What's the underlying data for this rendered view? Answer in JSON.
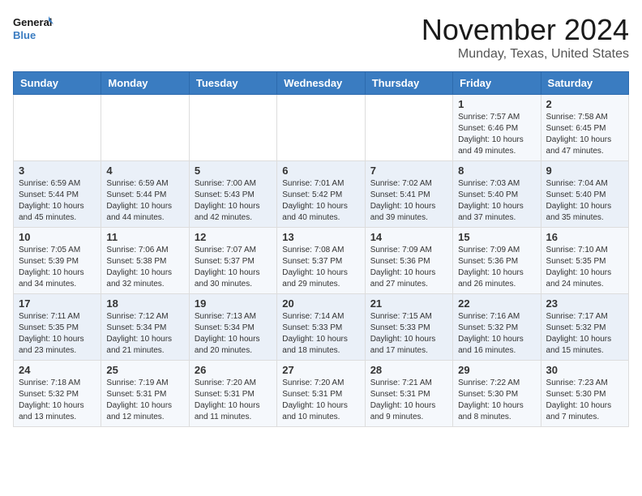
{
  "header": {
    "logo_line1": "General",
    "logo_line2": "Blue",
    "month": "November 2024",
    "location": "Munday, Texas, United States"
  },
  "weekdays": [
    "Sunday",
    "Monday",
    "Tuesday",
    "Wednesday",
    "Thursday",
    "Friday",
    "Saturday"
  ],
  "weeks": [
    [
      {
        "day": "",
        "info": ""
      },
      {
        "day": "",
        "info": ""
      },
      {
        "day": "",
        "info": ""
      },
      {
        "day": "",
        "info": ""
      },
      {
        "day": "",
        "info": ""
      },
      {
        "day": "1",
        "info": "Sunrise: 7:57 AM\nSunset: 6:46 PM\nDaylight: 10 hours\nand 49 minutes."
      },
      {
        "day": "2",
        "info": "Sunrise: 7:58 AM\nSunset: 6:45 PM\nDaylight: 10 hours\nand 47 minutes."
      }
    ],
    [
      {
        "day": "3",
        "info": "Sunrise: 6:59 AM\nSunset: 5:44 PM\nDaylight: 10 hours\nand 45 minutes."
      },
      {
        "day": "4",
        "info": "Sunrise: 6:59 AM\nSunset: 5:44 PM\nDaylight: 10 hours\nand 44 minutes."
      },
      {
        "day": "5",
        "info": "Sunrise: 7:00 AM\nSunset: 5:43 PM\nDaylight: 10 hours\nand 42 minutes."
      },
      {
        "day": "6",
        "info": "Sunrise: 7:01 AM\nSunset: 5:42 PM\nDaylight: 10 hours\nand 40 minutes."
      },
      {
        "day": "7",
        "info": "Sunrise: 7:02 AM\nSunset: 5:41 PM\nDaylight: 10 hours\nand 39 minutes."
      },
      {
        "day": "8",
        "info": "Sunrise: 7:03 AM\nSunset: 5:40 PM\nDaylight: 10 hours\nand 37 minutes."
      },
      {
        "day": "9",
        "info": "Sunrise: 7:04 AM\nSunset: 5:40 PM\nDaylight: 10 hours\nand 35 minutes."
      }
    ],
    [
      {
        "day": "10",
        "info": "Sunrise: 7:05 AM\nSunset: 5:39 PM\nDaylight: 10 hours\nand 34 minutes."
      },
      {
        "day": "11",
        "info": "Sunrise: 7:06 AM\nSunset: 5:38 PM\nDaylight: 10 hours\nand 32 minutes."
      },
      {
        "day": "12",
        "info": "Sunrise: 7:07 AM\nSunset: 5:37 PM\nDaylight: 10 hours\nand 30 minutes."
      },
      {
        "day": "13",
        "info": "Sunrise: 7:08 AM\nSunset: 5:37 PM\nDaylight: 10 hours\nand 29 minutes."
      },
      {
        "day": "14",
        "info": "Sunrise: 7:09 AM\nSunset: 5:36 PM\nDaylight: 10 hours\nand 27 minutes."
      },
      {
        "day": "15",
        "info": "Sunrise: 7:09 AM\nSunset: 5:36 PM\nDaylight: 10 hours\nand 26 minutes."
      },
      {
        "day": "16",
        "info": "Sunrise: 7:10 AM\nSunset: 5:35 PM\nDaylight: 10 hours\nand 24 minutes."
      }
    ],
    [
      {
        "day": "17",
        "info": "Sunrise: 7:11 AM\nSunset: 5:35 PM\nDaylight: 10 hours\nand 23 minutes."
      },
      {
        "day": "18",
        "info": "Sunrise: 7:12 AM\nSunset: 5:34 PM\nDaylight: 10 hours\nand 21 minutes."
      },
      {
        "day": "19",
        "info": "Sunrise: 7:13 AM\nSunset: 5:34 PM\nDaylight: 10 hours\nand 20 minutes."
      },
      {
        "day": "20",
        "info": "Sunrise: 7:14 AM\nSunset: 5:33 PM\nDaylight: 10 hours\nand 18 minutes."
      },
      {
        "day": "21",
        "info": "Sunrise: 7:15 AM\nSunset: 5:33 PM\nDaylight: 10 hours\nand 17 minutes."
      },
      {
        "day": "22",
        "info": "Sunrise: 7:16 AM\nSunset: 5:32 PM\nDaylight: 10 hours\nand 16 minutes."
      },
      {
        "day": "23",
        "info": "Sunrise: 7:17 AM\nSunset: 5:32 PM\nDaylight: 10 hours\nand 15 minutes."
      }
    ],
    [
      {
        "day": "24",
        "info": "Sunrise: 7:18 AM\nSunset: 5:32 PM\nDaylight: 10 hours\nand 13 minutes."
      },
      {
        "day": "25",
        "info": "Sunrise: 7:19 AM\nSunset: 5:31 PM\nDaylight: 10 hours\nand 12 minutes."
      },
      {
        "day": "26",
        "info": "Sunrise: 7:20 AM\nSunset: 5:31 PM\nDaylight: 10 hours\nand 11 minutes."
      },
      {
        "day": "27",
        "info": "Sunrise: 7:20 AM\nSunset: 5:31 PM\nDaylight: 10 hours\nand 10 minutes."
      },
      {
        "day": "28",
        "info": "Sunrise: 7:21 AM\nSunset: 5:31 PM\nDaylight: 10 hours\nand 9 minutes."
      },
      {
        "day": "29",
        "info": "Sunrise: 7:22 AM\nSunset: 5:30 PM\nDaylight: 10 hours\nand 8 minutes."
      },
      {
        "day": "30",
        "info": "Sunrise: 7:23 AM\nSunset: 5:30 PM\nDaylight: 10 hours\nand 7 minutes."
      }
    ]
  ]
}
